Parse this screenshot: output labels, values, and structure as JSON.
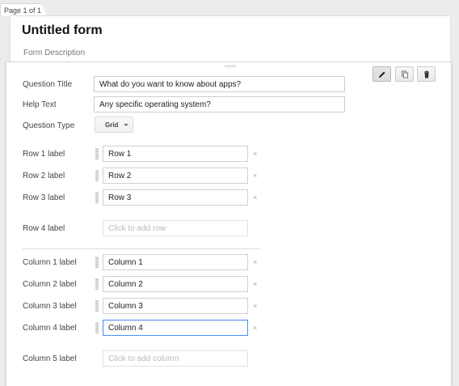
{
  "page_tab": {
    "label": "Page 1 of 1"
  },
  "form": {
    "title": "Untitled form",
    "description_placeholder": "Form Description"
  },
  "question": {
    "title_label": "Question Title",
    "title_value": "What do you want to know about apps?",
    "help_label": "Help Text",
    "help_value": "Any specific operating system?",
    "type_label": "Question Type",
    "type_value": "Grid",
    "rows": [
      {
        "label": "Row 1 label",
        "value": "Row 1"
      },
      {
        "label": "Row 2 label",
        "value": "Row 2"
      },
      {
        "label": "Row 3 label",
        "value": "Row 3"
      }
    ],
    "add_row": {
      "label": "Row 4 label",
      "placeholder": "Click to add row"
    },
    "columns": [
      {
        "label": "Column 1 label",
        "value": "Column 1"
      },
      {
        "label": "Column 2 label",
        "value": "Column 2"
      },
      {
        "label": "Column 3 label",
        "value": "Column 3"
      },
      {
        "label": "Column 4 label",
        "value": "Column 4"
      }
    ],
    "add_column": {
      "label": "Column 5 label",
      "placeholder": "Click to add column"
    },
    "remove_glyph": "×"
  },
  "toolbar": {
    "edit_icon": "pencil-icon",
    "duplicate_icon": "duplicate-icon",
    "delete_icon": "trash-icon"
  }
}
